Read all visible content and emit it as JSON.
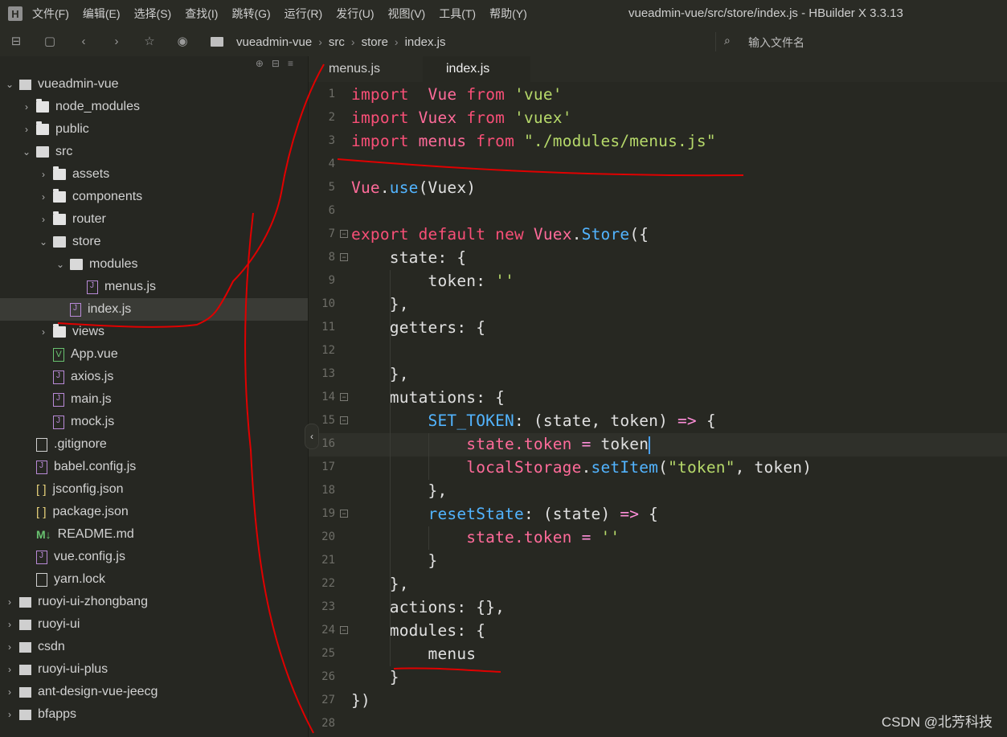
{
  "menubar": {
    "logo": "H",
    "items": [
      "文件(F)",
      "编辑(E)",
      "选择(S)",
      "查找(I)",
      "跳转(G)",
      "运行(R)",
      "发行(U)",
      "视图(V)",
      "工具(T)",
      "帮助(Y)"
    ],
    "window_title": "vueadmin-vue/src/store/index.js - HBuilder X 3.3.13"
  },
  "toolbar": {
    "breadcrumb": [
      "vueadmin-vue",
      "src",
      "store",
      "index.js"
    ],
    "search_placeholder": "输入文件名"
  },
  "sidebar": {
    "tree": [
      {
        "label": "vueadmin-vue",
        "depth": 0,
        "icon": "project",
        "chevron": "down"
      },
      {
        "label": "node_modules",
        "depth": 1,
        "icon": "folder",
        "chevron": "right"
      },
      {
        "label": "public",
        "depth": 1,
        "icon": "folder",
        "chevron": "right"
      },
      {
        "label": "src",
        "depth": 1,
        "icon": "folder-open",
        "chevron": "down"
      },
      {
        "label": "assets",
        "depth": 2,
        "icon": "folder",
        "chevron": "right"
      },
      {
        "label": "components",
        "depth": 2,
        "icon": "folder",
        "chevron": "right"
      },
      {
        "label": "router",
        "depth": 2,
        "icon": "folder",
        "chevron": "right"
      },
      {
        "label": "store",
        "depth": 2,
        "icon": "folder-open",
        "chevron": "down"
      },
      {
        "label": "modules",
        "depth": 3,
        "icon": "folder-open",
        "chevron": "down"
      },
      {
        "label": "menus.js",
        "depth": 4,
        "icon": "js",
        "chevron": ""
      },
      {
        "label": "index.js",
        "depth": 3,
        "icon": "js",
        "chevron": "",
        "selected": true
      },
      {
        "label": "views",
        "depth": 2,
        "icon": "folder",
        "chevron": "right"
      },
      {
        "label": "App.vue",
        "depth": 2,
        "icon": "vue",
        "chevron": ""
      },
      {
        "label": "axios.js",
        "depth": 2,
        "icon": "js",
        "chevron": ""
      },
      {
        "label": "main.js",
        "depth": 2,
        "icon": "js",
        "chevron": ""
      },
      {
        "label": "mock.js",
        "depth": 2,
        "icon": "js",
        "chevron": ""
      },
      {
        "label": ".gitignore",
        "depth": 1,
        "icon": "file",
        "chevron": ""
      },
      {
        "label": "babel.config.js",
        "depth": 1,
        "icon": "js",
        "chevron": ""
      },
      {
        "label": "jsconfig.json",
        "depth": 1,
        "icon": "json",
        "chevron": ""
      },
      {
        "label": "package.json",
        "depth": 1,
        "icon": "json",
        "chevron": ""
      },
      {
        "label": "README.md",
        "depth": 1,
        "icon": "md",
        "chevron": ""
      },
      {
        "label": "vue.config.js",
        "depth": 1,
        "icon": "js",
        "chevron": ""
      },
      {
        "label": "yarn.lock",
        "depth": 1,
        "icon": "file",
        "chevron": ""
      },
      {
        "label": "ruoyi-ui-zhongbang",
        "depth": 0,
        "icon": "project",
        "chevron": "right"
      },
      {
        "label": "ruoyi-ui",
        "depth": 0,
        "icon": "project",
        "chevron": "right"
      },
      {
        "label": "csdn",
        "depth": 0,
        "icon": "project",
        "chevron": "right"
      },
      {
        "label": "ruoyi-ui-plus",
        "depth": 0,
        "icon": "project",
        "chevron": "right"
      },
      {
        "label": "ant-design-vue-jeecg",
        "depth": 0,
        "icon": "project",
        "chevron": "right"
      },
      {
        "label": "bfapps",
        "depth": 0,
        "icon": "project",
        "chevron": "right"
      }
    ]
  },
  "tabs": [
    {
      "label": "menus.js",
      "active": false
    },
    {
      "label": "index.js",
      "active": true
    }
  ],
  "editor": {
    "current_line": 16,
    "lines": [
      {
        "n": 1,
        "fold": false,
        "tokens": [
          [
            "kw",
            "import"
          ],
          [
            "",
            "  "
          ],
          [
            "var",
            "Vue"
          ],
          [
            "",
            " "
          ],
          [
            "kw",
            "from"
          ],
          [
            "",
            " "
          ],
          [
            "str",
            "'vue'"
          ]
        ]
      },
      {
        "n": 2,
        "fold": false,
        "tokens": [
          [
            "kw",
            "import"
          ],
          [
            "",
            " "
          ],
          [
            "var",
            "Vuex"
          ],
          [
            "",
            " "
          ],
          [
            "kw",
            "from"
          ],
          [
            "",
            " "
          ],
          [
            "str",
            "'vuex'"
          ]
        ]
      },
      {
        "n": 3,
        "fold": false,
        "tokens": [
          [
            "kw",
            "import"
          ],
          [
            "",
            " "
          ],
          [
            "var",
            "menus"
          ],
          [
            "",
            " "
          ],
          [
            "kw",
            "from"
          ],
          [
            "",
            " "
          ],
          [
            "str",
            "\"./modules/menus.js\""
          ]
        ]
      },
      {
        "n": 4,
        "fold": false,
        "tokens": []
      },
      {
        "n": 5,
        "fold": false,
        "tokens": [
          [
            "var",
            "Vue"
          ],
          [
            "prop",
            "."
          ],
          [
            "fn",
            "use"
          ],
          [
            "prop",
            "(Vuex)"
          ]
        ]
      },
      {
        "n": 6,
        "fold": false,
        "tokens": []
      },
      {
        "n": 7,
        "fold": true,
        "tokens": [
          [
            "kw",
            "export"
          ],
          [
            "",
            " "
          ],
          [
            "kw",
            "default"
          ],
          [
            "",
            " "
          ],
          [
            "kw",
            "new"
          ],
          [
            "",
            " "
          ],
          [
            "var",
            "Vuex"
          ],
          [
            "prop",
            "."
          ],
          [
            "fn",
            "Store"
          ],
          [
            "prop",
            "({"
          ]
        ]
      },
      {
        "n": 8,
        "fold": true,
        "tokens": [
          [
            "",
            "    "
          ],
          [
            "prop",
            "state: {"
          ]
        ]
      },
      {
        "n": 9,
        "fold": false,
        "tokens": [
          [
            "",
            "        "
          ],
          [
            "prop",
            "token: "
          ],
          [
            "str",
            "''"
          ]
        ]
      },
      {
        "n": 10,
        "fold": false,
        "tokens": [
          [
            "",
            "    "
          ],
          [
            "prop",
            "},"
          ]
        ]
      },
      {
        "n": 11,
        "fold": false,
        "tokens": [
          [
            "",
            "    "
          ],
          [
            "prop",
            "getters: {"
          ]
        ]
      },
      {
        "n": 12,
        "fold": false,
        "tokens": []
      },
      {
        "n": 13,
        "fold": false,
        "tokens": [
          [
            "",
            "    "
          ],
          [
            "prop",
            "},"
          ]
        ]
      },
      {
        "n": 14,
        "fold": true,
        "tokens": [
          [
            "",
            "    "
          ],
          [
            "prop",
            "mutations: {"
          ]
        ]
      },
      {
        "n": 15,
        "fold": true,
        "tokens": [
          [
            "",
            "        "
          ],
          [
            "fn",
            "SET_TOKEN"
          ],
          [
            "prop",
            ": (state, token) "
          ],
          [
            "op",
            "=>"
          ],
          [
            "prop",
            " {"
          ]
        ]
      },
      {
        "n": 16,
        "fold": false,
        "tokens": [
          [
            "",
            "            "
          ],
          [
            "var",
            "state.token"
          ],
          [
            "prop",
            " "
          ],
          [
            "op",
            "="
          ],
          [
            "prop",
            " token"
          ]
        ],
        "cursor": true
      },
      {
        "n": 17,
        "fold": false,
        "tokens": [
          [
            "",
            "            "
          ],
          [
            "var",
            "localStorage"
          ],
          [
            "prop",
            "."
          ],
          [
            "fn",
            "setItem"
          ],
          [
            "prop",
            "("
          ],
          [
            "str",
            "\"token\""
          ],
          [
            "prop",
            ", token)"
          ]
        ]
      },
      {
        "n": 18,
        "fold": false,
        "tokens": [
          [
            "",
            "        "
          ],
          [
            "prop",
            "},"
          ]
        ]
      },
      {
        "n": 19,
        "fold": true,
        "tokens": [
          [
            "",
            "        "
          ],
          [
            "fn",
            "resetState"
          ],
          [
            "prop",
            ": (state) "
          ],
          [
            "op",
            "=>"
          ],
          [
            "prop",
            " {"
          ]
        ]
      },
      {
        "n": 20,
        "fold": false,
        "tokens": [
          [
            "",
            "            "
          ],
          [
            "var",
            "state.token"
          ],
          [
            "prop",
            " "
          ],
          [
            "op",
            "="
          ],
          [
            "prop",
            " "
          ],
          [
            "str",
            "''"
          ]
        ]
      },
      {
        "n": 21,
        "fold": false,
        "tokens": [
          [
            "",
            "        "
          ],
          [
            "prop",
            "}"
          ]
        ]
      },
      {
        "n": 22,
        "fold": false,
        "tokens": [
          [
            "",
            "    "
          ],
          [
            "prop",
            "},"
          ]
        ]
      },
      {
        "n": 23,
        "fold": false,
        "tokens": [
          [
            "",
            "    "
          ],
          [
            "prop",
            "actions: {},"
          ]
        ]
      },
      {
        "n": 24,
        "fold": true,
        "tokens": [
          [
            "",
            "    "
          ],
          [
            "prop",
            "modules: {"
          ]
        ]
      },
      {
        "n": 25,
        "fold": false,
        "tokens": [
          [
            "",
            "        "
          ],
          [
            "prop",
            "menus"
          ]
        ]
      },
      {
        "n": 26,
        "fold": false,
        "tokens": [
          [
            "",
            "    "
          ],
          [
            "prop",
            "}"
          ]
        ]
      },
      {
        "n": 27,
        "fold": false,
        "tokens": [
          [
            "prop",
            "})"
          ]
        ]
      },
      {
        "n": 28,
        "fold": false,
        "tokens": []
      }
    ]
  },
  "watermark": "CSDN @北芳科技",
  "colors": {
    "keyword": "#f84f77",
    "string": "#b6d96a",
    "function": "#52b4ff",
    "annotation": "#e00000"
  }
}
